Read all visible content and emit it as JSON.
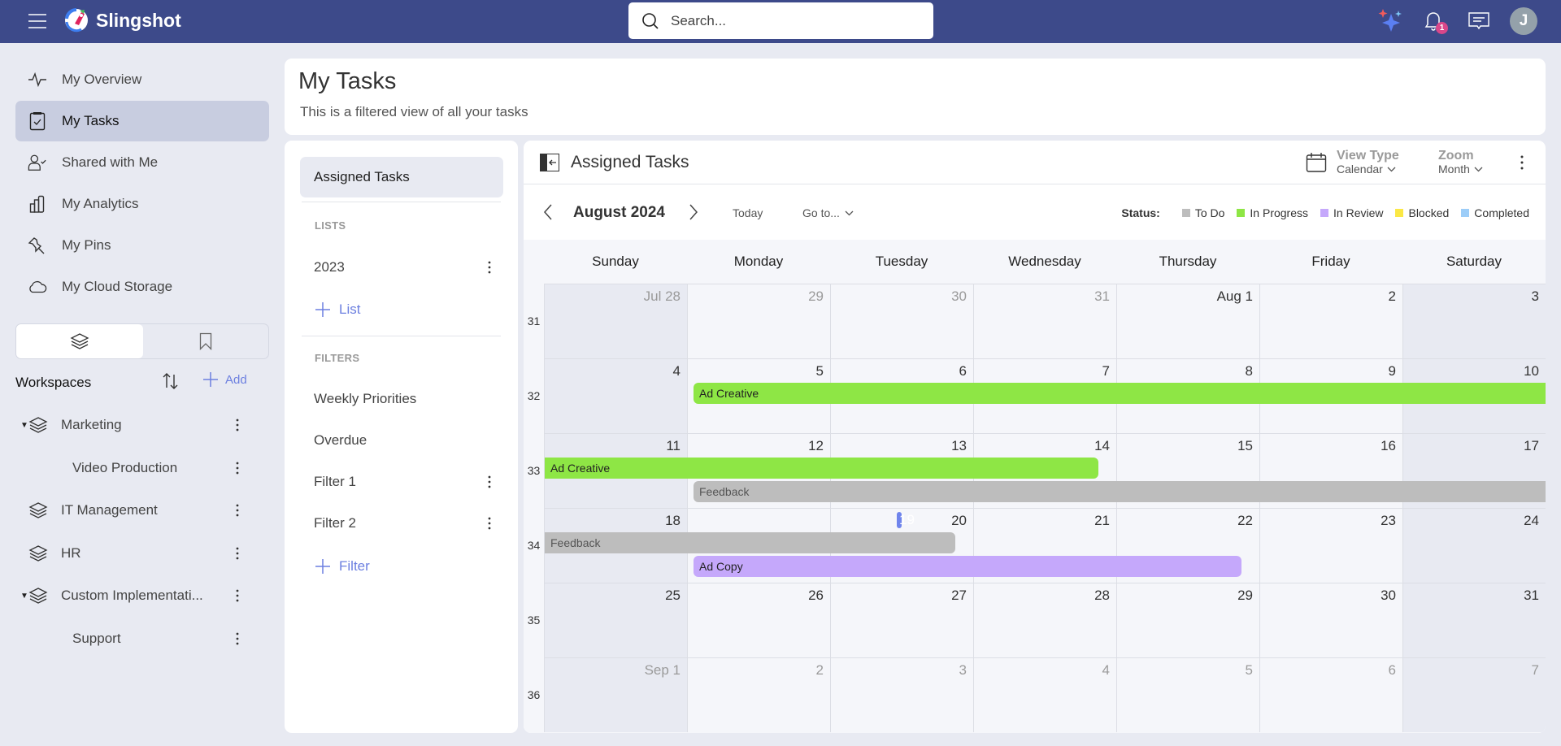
{
  "app": {
    "name": "Slingshot"
  },
  "topbar": {
    "search_placeholder": "Search...",
    "notification_count": "1",
    "avatar_initial": "J"
  },
  "sidebar": {
    "nav": [
      {
        "label": "My Overview",
        "icon": "activity-icon"
      },
      {
        "label": "My Tasks",
        "icon": "clipboard-check-icon",
        "active": true
      },
      {
        "label": "Shared with Me",
        "icon": "user-check-icon"
      },
      {
        "label": "My Analytics",
        "icon": "bar-chart-icon"
      },
      {
        "label": "My Pins",
        "icon": "pin-icon"
      },
      {
        "label": "My Cloud Storage",
        "icon": "cloud-icon"
      }
    ],
    "workspaces_title": "Workspaces",
    "add_label": "Add",
    "workspaces": [
      {
        "label": "Marketing",
        "expanded": true,
        "level": 0
      },
      {
        "label": "Video Production",
        "level": 1
      },
      {
        "label": "IT Management",
        "level": 0
      },
      {
        "label": "HR",
        "level": 0
      },
      {
        "label": "Custom Implementati...",
        "expanded": true,
        "level": 0
      },
      {
        "label": "Support",
        "level": 1
      }
    ]
  },
  "header": {
    "title": "My Tasks",
    "subtitle": "This is a filtered view of all your tasks"
  },
  "left_panel": {
    "selected": "Assigned Tasks",
    "lists_heading": "LISTS",
    "lists": [
      "2023"
    ],
    "add_list_label": "List",
    "filters_heading": "FILTERS",
    "filters": [
      {
        "label": "Weekly Priorities",
        "menu": false
      },
      {
        "label": "Overdue",
        "menu": false
      },
      {
        "label": "Filter 1",
        "menu": true
      },
      {
        "label": "Filter 2",
        "menu": true
      }
    ],
    "add_filter_label": "Filter"
  },
  "calendar": {
    "title": "Assigned Tasks",
    "view_type_label": "View Type",
    "view_type_value": "Calendar",
    "zoom_label": "Zoom",
    "zoom_value": "Month",
    "month_label": "August 2024",
    "today_label": "Today",
    "goto_label": "Go to...",
    "status_label": "Status:",
    "statuses": [
      {
        "label": "To Do",
        "color": "#bdbdbd"
      },
      {
        "label": "In Progress",
        "color": "#8ee645"
      },
      {
        "label": "In Review",
        "color": "#c5a8fb"
      },
      {
        "label": "Blocked",
        "color": "#fbe845"
      },
      {
        "label": "Completed",
        "color": "#9ccdf8"
      }
    ],
    "days_of_week": [
      "Sunday",
      "Monday",
      "Tuesday",
      "Wednesday",
      "Thursday",
      "Friday",
      "Saturday"
    ],
    "weeks": [
      {
        "week": "31",
        "days": [
          {
            "d": "Jul 28",
            "o": true
          },
          {
            "d": "29",
            "o": true
          },
          {
            "d": "30",
            "o": true
          },
          {
            "d": "31",
            "o": true
          },
          {
            "d": "Aug 1"
          },
          {
            "d": "2"
          },
          {
            "d": "3"
          }
        ]
      },
      {
        "week": "32",
        "days": [
          {
            "d": "4"
          },
          {
            "d": "5"
          },
          {
            "d": "6"
          },
          {
            "d": "7"
          },
          {
            "d": "8"
          },
          {
            "d": "9"
          },
          {
            "d": "10"
          }
        ]
      },
      {
        "week": "33",
        "days": [
          {
            "d": "11"
          },
          {
            "d": "12"
          },
          {
            "d": "13"
          },
          {
            "d": "14"
          },
          {
            "d": "15"
          },
          {
            "d": "16"
          },
          {
            "d": "17"
          }
        ]
      },
      {
        "week": "34",
        "days": [
          {
            "d": "18"
          },
          {
            "d": "19",
            "today": true
          },
          {
            "d": "20"
          },
          {
            "d": "21"
          },
          {
            "d": "22"
          },
          {
            "d": "23"
          },
          {
            "d": "24"
          }
        ]
      },
      {
        "week": "35",
        "days": [
          {
            "d": "25"
          },
          {
            "d": "26"
          },
          {
            "d": "27"
          },
          {
            "d": "28"
          },
          {
            "d": "29"
          },
          {
            "d": "30"
          },
          {
            "d": "31"
          }
        ]
      },
      {
        "week": "36",
        "days": [
          {
            "d": "Sep 1",
            "o": true
          },
          {
            "d": "2",
            "o": true
          },
          {
            "d": "3",
            "o": true
          },
          {
            "d": "4",
            "o": true
          },
          {
            "d": "5",
            "o": true
          },
          {
            "d": "6",
            "o": true
          },
          {
            "d": "7",
            "o": true
          }
        ]
      }
    ],
    "events": [
      {
        "title": "Ad Creative",
        "status": "In Progress",
        "start": "2024-08-05",
        "end": "2024-08-14"
      },
      {
        "title": "Feedback",
        "status": "To Do",
        "start": "2024-08-12",
        "end": "2024-08-20"
      },
      {
        "title": "Ad Copy",
        "status": "In Review",
        "start": "2024-08-19",
        "end": "2024-08-22"
      }
    ]
  }
}
